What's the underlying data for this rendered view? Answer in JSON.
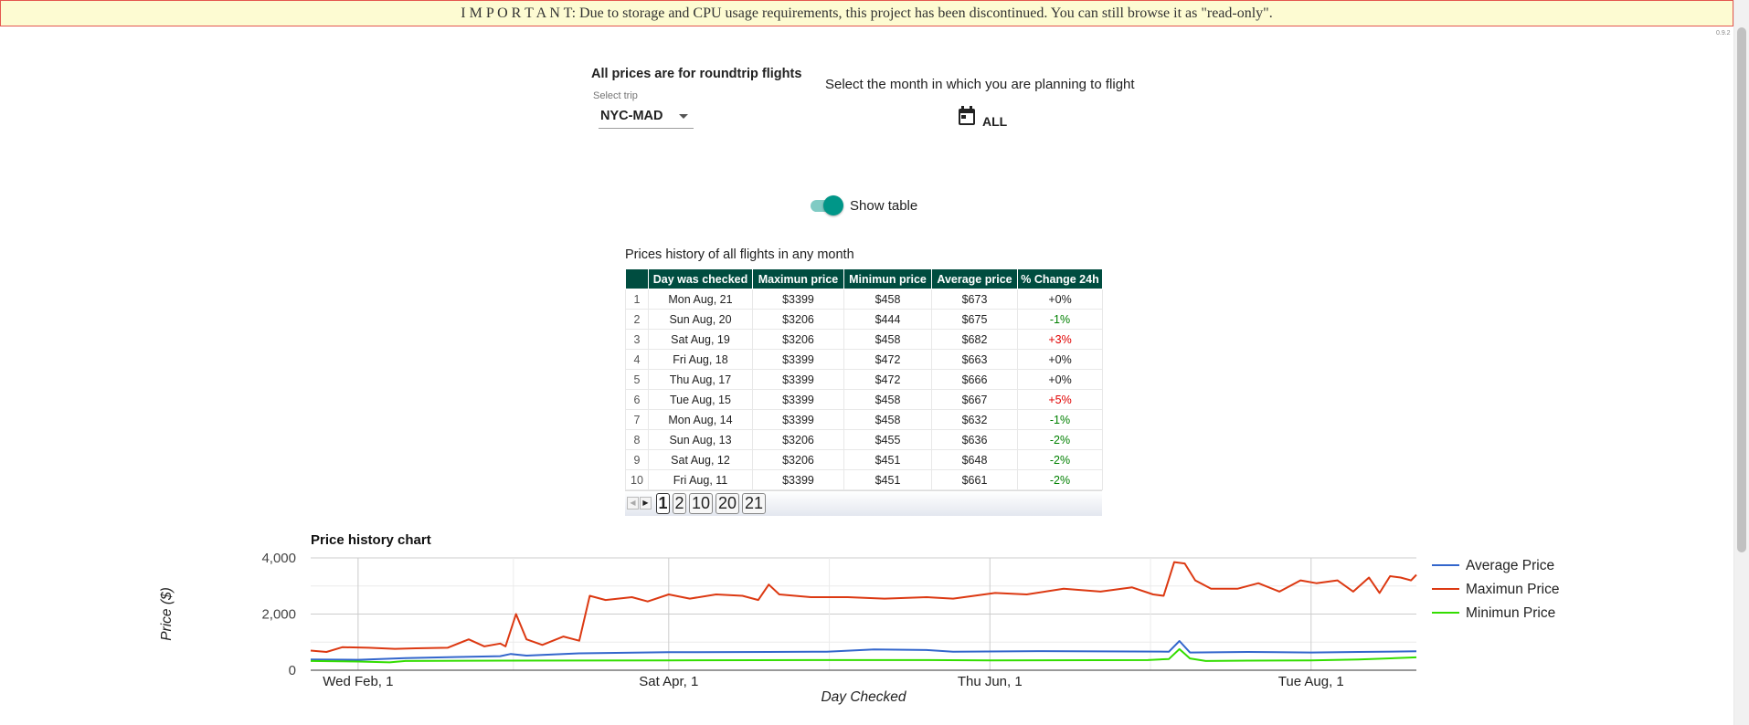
{
  "banner": {
    "text": "I M P O R T A N T: Due to storage and CPU usage requirements, this project has been discontinued. You can still browse it as \"read-only\"."
  },
  "version": "0.9.2",
  "controls": {
    "note": "All prices are for roundtrip flights",
    "trip_label": "Select trip",
    "trip_value": "NYC-MAD",
    "month_prompt": "Select the month in which you are planning to flight",
    "month_value": "ALL",
    "toggle_label": "Show table"
  },
  "colors": {
    "header_bg": "#004d40",
    "accent": "#009688",
    "positive_change": "#e00000",
    "negative_change": "#008000"
  },
  "table": {
    "title": "Prices history of all flights in any month",
    "headers": [
      "",
      "Day was checked",
      "Maximun price",
      "Minimun price",
      "Average price",
      "% Change 24h"
    ],
    "rows": [
      {
        "idx": "1",
        "day": "Mon Aug, 21",
        "max": "$3399",
        "min": "$458",
        "avg": "$673",
        "chg": "+0%"
      },
      {
        "idx": "2",
        "day": "Sun Aug, 20",
        "max": "$3206",
        "min": "$444",
        "avg": "$675",
        "chg": "-1%"
      },
      {
        "idx": "3",
        "day": "Sat Aug, 19",
        "max": "$3206",
        "min": "$458",
        "avg": "$682",
        "chg": "+3%"
      },
      {
        "idx": "4",
        "day": "Fri Aug, 18",
        "max": "$3399",
        "min": "$472",
        "avg": "$663",
        "chg": "+0%"
      },
      {
        "idx": "5",
        "day": "Thu Aug, 17",
        "max": "$3399",
        "min": "$472",
        "avg": "$666",
        "chg": "+0%"
      },
      {
        "idx": "6",
        "day": "Tue Aug, 15",
        "max": "$3399",
        "min": "$458",
        "avg": "$667",
        "chg": "+5%"
      },
      {
        "idx": "7",
        "day": "Mon Aug, 14",
        "max": "$3399",
        "min": "$458",
        "avg": "$632",
        "chg": "-1%"
      },
      {
        "idx": "8",
        "day": "Sun Aug, 13",
        "max": "$3206",
        "min": "$455",
        "avg": "$636",
        "chg": "-2%"
      },
      {
        "idx": "9",
        "day": "Sat Aug, 12",
        "max": "$3206",
        "min": "$451",
        "avg": "$648",
        "chg": "-2%"
      },
      {
        "idx": "10",
        "day": "Fri Aug, 11",
        "max": "$3399",
        "min": "$451",
        "avg": "$661",
        "chg": "-2%"
      }
    ],
    "pager": {
      "pages": [
        "1",
        "2",
        "10",
        "20",
        "21"
      ],
      "current": "1"
    }
  },
  "chart_data": {
    "type": "line",
    "title": "Price history chart",
    "xlabel": "Day Checked",
    "ylabel": "Price ($)",
    "x_ticks": [
      "Wed Feb, 1",
      "Sat Apr, 1",
      "Thu Jun, 1",
      "Tue Aug, 1"
    ],
    "x_tick_dates": [
      "2017-02-01",
      "2017-04-01",
      "2017-06-01",
      "2017-08-01"
    ],
    "x_range": [
      "2017-01-23",
      "2017-08-21"
    ],
    "y_ticks": [
      "0",
      "2,000",
      "4,000"
    ],
    "ylim": [
      0,
      4000
    ],
    "grid": true,
    "legend_position": "right",
    "series": [
      {
        "name": "Average Price",
        "color": "#3366cc",
        "points": [
          [
            "2017-01-23",
            380
          ],
          [
            "2017-02-01",
            370
          ],
          [
            "2017-02-10",
            430
          ],
          [
            "2017-02-20",
            470
          ],
          [
            "2017-02-28",
            500
          ],
          [
            "2017-03-02",
            580
          ],
          [
            "2017-03-05",
            520
          ],
          [
            "2017-03-10",
            560
          ],
          [
            "2017-03-15",
            600
          ],
          [
            "2017-04-01",
            640
          ],
          [
            "2017-04-20",
            650
          ],
          [
            "2017-05-01",
            660
          ],
          [
            "2017-05-10",
            740
          ],
          [
            "2017-05-20",
            720
          ],
          [
            "2017-05-25",
            660
          ],
          [
            "2017-06-10",
            680
          ],
          [
            "2017-07-05",
            660
          ],
          [
            "2017-07-07",
            1040
          ],
          [
            "2017-07-09",
            630
          ],
          [
            "2017-07-20",
            650
          ],
          [
            "2017-08-01",
            630
          ],
          [
            "2017-08-10",
            650
          ],
          [
            "2017-08-21",
            673
          ]
        ]
      },
      {
        "name": "Maximun Price",
        "color": "#dc3912",
        "points": [
          [
            "2017-01-23",
            700
          ],
          [
            "2017-01-26",
            650
          ],
          [
            "2017-01-29",
            820
          ],
          [
            "2017-02-03",
            800
          ],
          [
            "2017-02-08",
            760
          ],
          [
            "2017-02-12",
            780
          ],
          [
            "2017-02-18",
            800
          ],
          [
            "2017-02-22",
            1100
          ],
          [
            "2017-02-25",
            850
          ],
          [
            "2017-02-28",
            950
          ],
          [
            "2017-03-01",
            850
          ],
          [
            "2017-03-03",
            2000
          ],
          [
            "2017-03-05",
            1100
          ],
          [
            "2017-03-08",
            900
          ],
          [
            "2017-03-12",
            1200
          ],
          [
            "2017-03-15",
            1050
          ],
          [
            "2017-03-17",
            2650
          ],
          [
            "2017-03-20",
            2500
          ],
          [
            "2017-03-25",
            2600
          ],
          [
            "2017-03-28",
            2450
          ],
          [
            "2017-04-01",
            2700
          ],
          [
            "2017-04-05",
            2550
          ],
          [
            "2017-04-10",
            2700
          ],
          [
            "2017-04-15",
            2650
          ],
          [
            "2017-04-18",
            2500
          ],
          [
            "2017-04-20",
            3050
          ],
          [
            "2017-04-22",
            2700
          ],
          [
            "2017-04-28",
            2600
          ],
          [
            "2017-05-05",
            2600
          ],
          [
            "2017-05-12",
            2550
          ],
          [
            "2017-05-20",
            2600
          ],
          [
            "2017-05-25",
            2550
          ],
          [
            "2017-06-02",
            2750
          ],
          [
            "2017-06-08",
            2700
          ],
          [
            "2017-06-15",
            2900
          ],
          [
            "2017-06-22",
            2800
          ],
          [
            "2017-06-28",
            2950
          ],
          [
            "2017-07-02",
            2700
          ],
          [
            "2017-07-04",
            2650
          ],
          [
            "2017-07-06",
            3850
          ],
          [
            "2017-07-08",
            3800
          ],
          [
            "2017-07-10",
            3200
          ],
          [
            "2017-07-13",
            2900
          ],
          [
            "2017-07-18",
            2900
          ],
          [
            "2017-07-22",
            3100
          ],
          [
            "2017-07-26",
            2800
          ],
          [
            "2017-07-30",
            3200
          ],
          [
            "2017-08-02",
            3100
          ],
          [
            "2017-08-06",
            3200
          ],
          [
            "2017-08-09",
            2800
          ],
          [
            "2017-08-12",
            3300
          ],
          [
            "2017-08-14",
            2750
          ],
          [
            "2017-08-16",
            3350
          ],
          [
            "2017-08-18",
            3300
          ],
          [
            "2017-08-20",
            3200
          ],
          [
            "2017-08-21",
            3399
          ]
        ]
      },
      {
        "name": "Minimun Price",
        "color": "#33dd00",
        "points": [
          [
            "2017-01-23",
            330
          ],
          [
            "2017-02-01",
            310
          ],
          [
            "2017-02-07",
            280
          ],
          [
            "2017-02-10",
            330
          ],
          [
            "2017-03-01",
            340
          ],
          [
            "2017-04-01",
            350
          ],
          [
            "2017-05-01",
            360
          ],
          [
            "2017-05-20",
            360
          ],
          [
            "2017-06-01",
            350
          ],
          [
            "2017-07-01",
            360
          ],
          [
            "2017-07-05",
            400
          ],
          [
            "2017-07-07",
            750
          ],
          [
            "2017-07-09",
            420
          ],
          [
            "2017-07-12",
            330
          ],
          [
            "2017-07-20",
            340
          ],
          [
            "2017-08-01",
            350
          ],
          [
            "2017-08-10",
            380
          ],
          [
            "2017-08-21",
            458
          ]
        ]
      }
    ]
  }
}
